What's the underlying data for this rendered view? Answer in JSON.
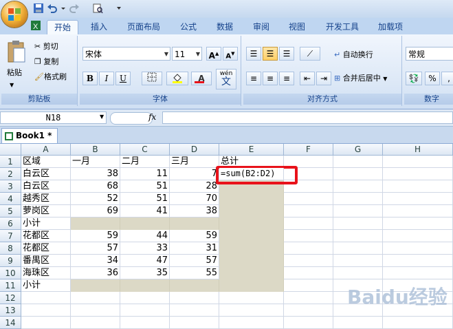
{
  "ribbon_tabs": [
    "开始",
    "插入",
    "页面布局",
    "公式",
    "数据",
    "审阅",
    "视图",
    "开发工具",
    "加载项"
  ],
  "clipboard": {
    "paste": "粘贴",
    "cut": "剪切",
    "copy": "复制",
    "format_painter": "格式刷",
    "label": "剪贴板"
  },
  "font": {
    "name": "宋体",
    "size": "11",
    "bold": "B",
    "italic": "I",
    "underline": "U",
    "label": "字体",
    "color_letter": "A",
    "wen": "wén",
    "wen_char": "文"
  },
  "alignment": {
    "wrap": "自动换行",
    "merge": "合并后居中",
    "label": "对齐方式"
  },
  "number": {
    "format": "常规",
    "percent": "%",
    "comma": ",",
    "label": "数字"
  },
  "formula_bar": {
    "name_box": "N18",
    "fx": "fx",
    "content": ""
  },
  "workbook_tab": "Book1 *",
  "sheet": {
    "columns": [
      "A",
      "B",
      "C",
      "D",
      "E",
      "F",
      "G",
      "H"
    ],
    "rows": [
      "1",
      "2",
      "3",
      "4",
      "5",
      "6",
      "7",
      "8",
      "9",
      "10",
      "11",
      "12",
      "13",
      "14"
    ],
    "cells": [
      [
        "区域",
        "一月",
        "二月",
        "三月",
        "总计"
      ],
      [
        "白云区",
        "38",
        "11",
        "7",
        ""
      ],
      [
        "白云区",
        "68",
        "51",
        "28",
        ""
      ],
      [
        "越秀区",
        "52",
        "51",
        "70",
        ""
      ],
      [
        "萝岗区",
        "69",
        "41",
        "38",
        ""
      ],
      [
        "小计",
        "",
        "",
        "",
        ""
      ],
      [
        "花都区",
        "59",
        "44",
        "59",
        ""
      ],
      [
        "花都区",
        "57",
        "33",
        "31",
        ""
      ],
      [
        "番禺区",
        "34",
        "47",
        "57",
        ""
      ],
      [
        "海珠区",
        "36",
        "35",
        "55",
        ""
      ],
      [
        "小计",
        "",
        "",
        "",
        ""
      ]
    ],
    "editing_cell": "=sum(B2:D2)"
  },
  "watermark": "Baidu经验",
  "colors": {
    "selection_shade": "#dcd9c6",
    "highlight_border": "#e8121a",
    "ribbon_blue": "#15428b"
  }
}
